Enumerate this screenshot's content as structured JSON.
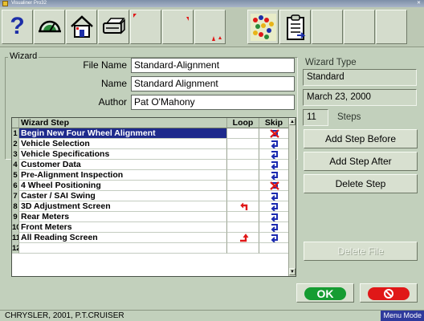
{
  "window": {
    "title": "Visualiner Pro32"
  },
  "toolbar": {
    "buttons": [
      {
        "name": "help",
        "icon": "question-icon"
      },
      {
        "name": "speedometer",
        "icon": "gauge-icon"
      },
      {
        "name": "home",
        "icon": "home-icon"
      },
      {
        "name": "print",
        "icon": "printer-icon"
      },
      {
        "name": "blank1",
        "icon": "corner-marker-icon"
      },
      {
        "name": "blank2",
        "icon": "corner-marker-icon"
      },
      {
        "name": "blank3",
        "icon": "corner-marker-icon"
      },
      {
        "name": "wizard",
        "icon": "wizard-dots-icon"
      },
      {
        "name": "clipboard",
        "icon": "clipboard-list-icon"
      }
    ]
  },
  "wizard": {
    "group_label": "Wizard",
    "file_name_label": "File Name",
    "file_name": "Standard-Alignment",
    "name_label": "Name",
    "name": "Standard Alignment",
    "author_label": "Author",
    "author": "Pat O'Mahony",
    "type_label": "Wizard Type",
    "type_value": "Standard",
    "date": "March 23, 2000",
    "steps_count": "11",
    "steps_label": "Steps"
  },
  "grid": {
    "headers": {
      "step": "Wizard Step",
      "loop": "Loop",
      "skip": "Skip"
    },
    "selected_row": 1,
    "rows": [
      {
        "num": "1",
        "step": "Begin New Four Wheel Alignment",
        "loop": "",
        "skip": "no-skip"
      },
      {
        "num": "2",
        "step": "Vehicle Selection",
        "loop": "",
        "skip": "skip"
      },
      {
        "num": "3",
        "step": "Vehicle Specifications",
        "loop": "",
        "skip": "skip"
      },
      {
        "num": "4",
        "step": "Customer Data",
        "loop": "",
        "skip": "skip"
      },
      {
        "num": "5",
        "step": "Pre-Alignment Inspection",
        "loop": "",
        "skip": "skip"
      },
      {
        "num": "6",
        "step": "4 Wheel Positioning",
        "loop": "",
        "skip": "no-skip"
      },
      {
        "num": "7",
        "step": "Caster / SAI Swing",
        "loop": "",
        "skip": "skip"
      },
      {
        "num": "8",
        "step": "3D Adjustment Screen",
        "loop": "loop-back",
        "skip": "skip"
      },
      {
        "num": "9",
        "step": "Rear Meters",
        "loop": "",
        "skip": "skip"
      },
      {
        "num": "10",
        "step": "Front Meters",
        "loop": "",
        "skip": "skip"
      },
      {
        "num": "11",
        "step": "All Reading Screen",
        "loop": "loop-up",
        "skip": "skip"
      },
      {
        "num": "12",
        "step": "",
        "loop": "",
        "skip": ""
      }
    ]
  },
  "actions": {
    "add_before": "Add Step Before",
    "add_after": "Add Step After",
    "delete_step": "Delete Step",
    "delete_file": "Delete File",
    "ok": "OK"
  },
  "status": {
    "vehicle": "CHRYSLER, 2001, P.T.CRUISER",
    "mode": "Menu Mode"
  },
  "colors": {
    "selection": "#1e2a8c",
    "ok": "#169c32",
    "cancel": "#e01818",
    "skip_arrow": "#1a2ab0",
    "loop_arrow": "#e01818"
  }
}
